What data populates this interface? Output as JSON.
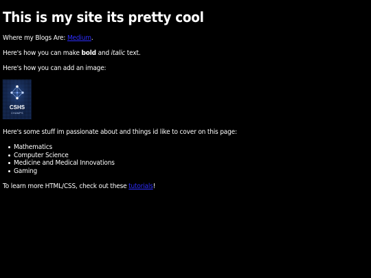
{
  "page": {
    "title": "This is my site its pretty cool",
    "blogs": {
      "prefix": "Where my Blogs Are: ",
      "link_text": "Medium",
      "suffix": "."
    },
    "formatting": {
      "prefix": "Here's how you can make ",
      "bold": "bold",
      "middle": " and ",
      "italic": "italic",
      "suffix": " text."
    },
    "image_intro": "Here's how you can add an image:",
    "logo": {
      "icon": "cshs-champs-logo",
      "text_line1": "CSHS",
      "text_line2": "CHAMPS"
    },
    "passions_intro": "Here's some stuff im passionate about and things id like to cover on this page:",
    "passions": [
      "Mathematics",
      "Computer Science",
      "Medicine and Medical Innovations",
      "Gaming"
    ],
    "learn_more": {
      "prefix": "To learn more HTML/CSS, check out these ",
      "link_text": "tutorials",
      "suffix": "!"
    },
    "colors": {
      "background": "#000000",
      "text": "#ffffff",
      "link": "#2d2dff"
    }
  }
}
